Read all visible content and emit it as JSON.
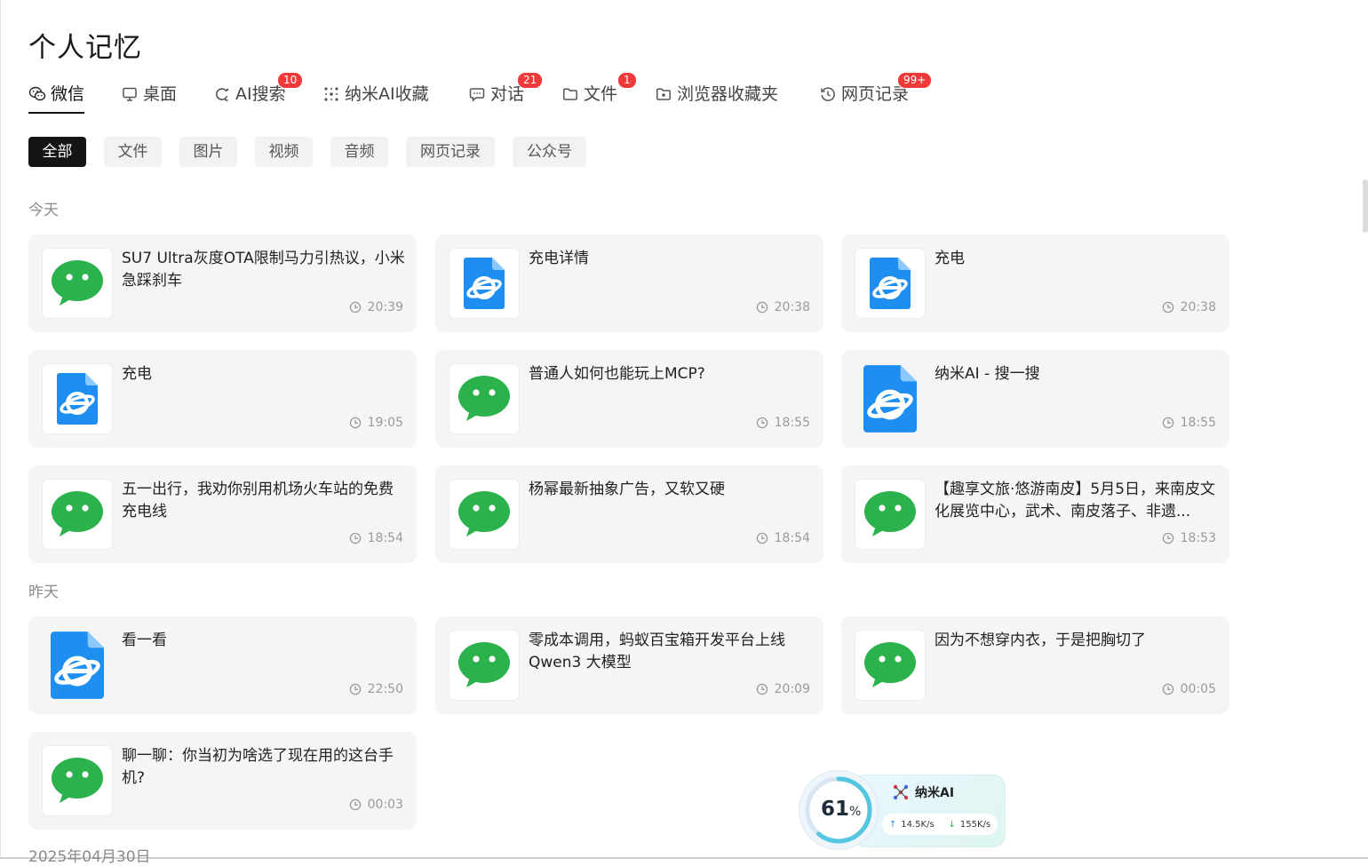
{
  "page": {
    "title": "个人记忆"
  },
  "tabs": [
    {
      "label": "微信",
      "icon": "wechat-icon",
      "active": true,
      "badge": ""
    },
    {
      "label": "桌面",
      "icon": "monitor-icon",
      "badge": ""
    },
    {
      "label": "AI搜索",
      "icon": "ai-search-icon",
      "badge": "10"
    },
    {
      "label": "纳米AI收藏",
      "icon": "nano-ai-icon",
      "badge": ""
    },
    {
      "label": "对话",
      "icon": "chat-icon",
      "badge": "21"
    },
    {
      "label": "文件",
      "icon": "folder-icon",
      "badge": "1"
    },
    {
      "label": "浏览器收藏夹",
      "icon": "bookmark-folder-icon",
      "badge": ""
    },
    {
      "label": "网页记录",
      "icon": "history-icon",
      "badge": "99+"
    }
  ],
  "filters": [
    "全部",
    "文件",
    "图片",
    "视频",
    "音频",
    "网页记录",
    "公众号"
  ],
  "sections": [
    {
      "label": "今天",
      "items": [
        {
          "title": "SU7 Ultra灰度OTA限制马力引热议，小米急踩刹车",
          "time": "20:39",
          "icon": "wechat-logo-icon"
        },
        {
          "title": "充电详情",
          "time": "20:38",
          "icon": "browser-logo-icon"
        },
        {
          "title": "充电",
          "time": "20:38",
          "icon": "browser-logo-icon"
        },
        {
          "title": "充电",
          "time": "19:05",
          "icon": "browser-logo-icon"
        },
        {
          "title": "普通人如何也能玩上MCP?",
          "time": "18:55",
          "icon": "wechat-logo-icon"
        },
        {
          "title": "纳米AI - 搜一搜",
          "time": "18:55",
          "icon": "browser-logo-icon"
        },
        {
          "title": "五一出行，我劝你别用机场火车站的免费充电线",
          "time": "18:54",
          "icon": "wechat-logo-icon"
        },
        {
          "title": "杨幂最新抽象广告，又软又硬",
          "time": "18:54",
          "icon": "wechat-logo-icon"
        },
        {
          "title": "【趣享文旅·悠游南皮】5月5日，来南皮文化展览中心，武术、南皮落子、非遗...",
          "time": "18:53",
          "icon": "wechat-logo-icon"
        }
      ]
    },
    {
      "label": "昨天",
      "items": [
        {
          "title": "看一看",
          "time": "22:50",
          "icon": "browser-logo-icon"
        },
        {
          "title": "零成本调用，蚂蚁百宝箱开发平台上线Qwen3 大模型",
          "time": "20:09",
          "icon": "wechat-logo-icon"
        },
        {
          "title": "因为不想穿内衣，于是把胸切了",
          "time": "00:05",
          "icon": "wechat-logo-icon"
        },
        {
          "title": "聊一聊：你当初为啥选了现在用的这台手机?",
          "time": "00:03",
          "icon": "wechat-logo-icon"
        }
      ]
    },
    {
      "label": "2025年04月30日",
      "items": []
    }
  ],
  "widget": {
    "percent": "61",
    "percent_unit": "%",
    "percent_value": 0.61,
    "brand": "纳米AI",
    "upload_speed": "14.5K/s",
    "download_speed": "155K/s"
  },
  "colors": {
    "wechat_green": "#2bb24c",
    "browser_blue": "#1f8ef1",
    "badge_red": "#f03a3a",
    "active_chip": "#151515"
  }
}
